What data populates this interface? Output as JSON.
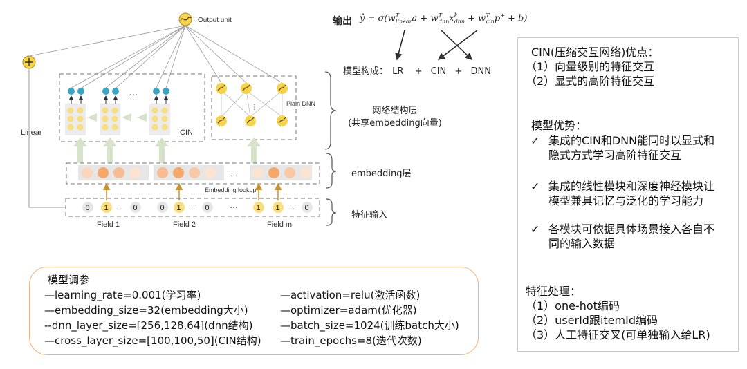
{
  "diagram": {
    "output_unit": "Output unit",
    "linear": "Linear",
    "cin": "CIN",
    "plain_dnn": "Plain DNN",
    "ellipsis": "…",
    "embedding_lookup": "Embedding lookup",
    "field1": "Field 1",
    "field2": "Field 2",
    "fieldm": "Field m",
    "f1_values": [
      "0",
      "1",
      "0"
    ],
    "f2_values": [
      "0",
      "1",
      "0"
    ],
    "fm_values": [
      "1",
      "1",
      "0"
    ],
    "dots": "…"
  },
  "formula": {
    "label": "输出",
    "model_composition_label": "模型构成：",
    "lr": "LR",
    "cin": "CIN",
    "dnn": "DNN",
    "plus": "+"
  },
  "layers": {
    "network_line1": "网络结构层",
    "network_line2": "(共享embedding向量)",
    "embedding": "embedding层",
    "feature_input": "特征输入"
  },
  "side_panel": {
    "cin_title": "CIN(压缩交互网络)优点：",
    "cin_points": [
      "（1）向量级别的特征交互",
      "（2）显式的高阶特征交互"
    ],
    "adv_title": "模型优势：",
    "advantages": [
      "集成的CIN和DNN能同时以显式和隐式方式学习高阶特征交互",
      "集成的线性模块和深度神经模块让模型兼具记忆与泛化的学习能力",
      "各模块可依据具体场景接入各自不同的输入数据"
    ],
    "check": "✓",
    "feat_title": "特征处理：",
    "feat_points": [
      "（1）one-hot编码",
      "（2）userId跟itemId编码",
      "（3）人工特征交叉(可单独输入给LR)"
    ]
  },
  "tuning": {
    "title": "模型调参",
    "left": [
      "—learning_rate=0.001(学习率)",
      "—embedding_size=32(embedding大小)",
      "--dnn_layer_size=[256,128,64](dnn结构)",
      "—cross_layer_size=[100,100,50](CIN结构)"
    ],
    "right": [
      "—activation=relu(激活函数)",
      "—optimizer=adam(优化器)",
      "—batch_size=1024(训练batch大小)",
      "—train_epochs=8(迭代次数)"
    ]
  },
  "colors": {
    "blue": "#3aa6c4",
    "yellow": "#f8de7e",
    "orange": "#f0a15a",
    "pale": "#fce3d2",
    "arrow_green": "#d5e3c8"
  }
}
